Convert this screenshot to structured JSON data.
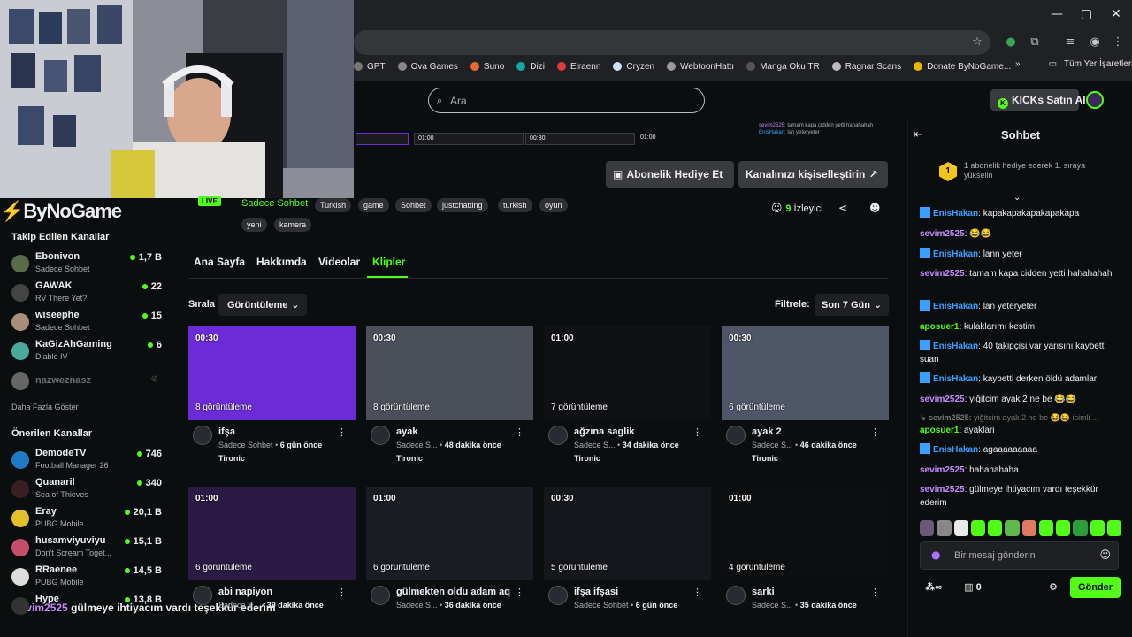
{
  "browser": {
    "bookmarks": [
      {
        "label": "GPT",
        "color": "#777"
      },
      {
        "label": "Ova Games",
        "color": "#888"
      },
      {
        "label": "Suno",
        "color": "#e66b2e"
      },
      {
        "label": "Dizi",
        "color": "#13a9a0"
      },
      {
        "label": "Elraenn",
        "color": "#e03a3a"
      },
      {
        "label": "Cryzen",
        "color": "#cfe0ff"
      },
      {
        "label": "WebtoonHattı",
        "color": "#999"
      },
      {
        "label": "Manga Oku TR",
        "color": "#555"
      },
      {
        "label": "Ragnar Scans",
        "color": "#bbb"
      },
      {
        "label": "Donate ByNoGame...",
        "color": "#e6b800"
      }
    ],
    "overflow": "»",
    "all_bookmarks": "Tüm Yer İşaretleri"
  },
  "header": {
    "search_placeholder": "Ara",
    "kicks_button": "KICKs Satın Al"
  },
  "brand": "ByNoGame",
  "sidebar": {
    "followed_title": "Takip Edilen Kanallar",
    "followed": [
      {
        "name": "Ebonivon",
        "game": "Sadece Sohbet",
        "viewers": "1,7 B",
        "color": "#5a6b4a"
      },
      {
        "name": "GAWAK",
        "game": "RV There Yet?",
        "viewers": "22",
        "color": "#444"
      },
      {
        "name": "wiseephe",
        "game": "Sadece Sohbet",
        "viewers": "15",
        "color": "#a98f7a"
      },
      {
        "name": "KaGizAhGaming",
        "game": "Diablo IV",
        "viewers": "6",
        "color": "#4aa99b"
      }
    ],
    "offline": {
      "name": "nazweznasz",
      "color": "#666"
    },
    "show_more": "Daha Fazla Göster",
    "recommended_title": "Önerilen Kanallar",
    "recommended": [
      {
        "name": "DemodeTV",
        "game": "Football Manager 26",
        "viewers": "746",
        "color": "#1f7cc4"
      },
      {
        "name": "Quanaril",
        "game": "Sea of Thieves",
        "viewers": "340",
        "color": "#3a1f22"
      },
      {
        "name": "Eray",
        "game": "PUBG Mobile",
        "viewers": "20,1 B",
        "color": "#e3c02a"
      },
      {
        "name": "husamviyuviyu",
        "game": "Don't Scream Toget...",
        "viewers": "15,1 B",
        "color": "#c44e6a"
      },
      {
        "name": "RRaenee",
        "game": "PUBG Mobile",
        "viewers": "14,5 B",
        "color": "#ddd"
      },
      {
        "name": "Hype",
        "game": "",
        "viewers": "13,8 B",
        "color": "#333"
      }
    ]
  },
  "overlay_message": {
    "user": "sevim2525",
    "text": "gülmeye ihtiyacım vardı teşekkür ederim"
  },
  "channel": {
    "live": "LIVE",
    "category": "Sadece Sohbet",
    "tags": [
      "Turkish",
      "game",
      "Sohbet",
      "justchatting",
      "turkish",
      "oyun",
      "yeni",
      "kamera"
    ],
    "gift_button": "Abonelik Hediye Et",
    "customize_button": "Kanalınızı kişiselleştirin",
    "viewers_count": "9",
    "viewers_label": "İzleyici",
    "tabs": [
      "Ana Sayfa",
      "Hakkımda",
      "Videolar",
      "Klipler"
    ]
  },
  "preview": {
    "times": [
      "01:00",
      "00:30",
      "01:00"
    ],
    "chat_snippet_user": "sevim2525:",
    "chat_snippet_text": "tamam kapa cidden yetti hahahahah",
    "chat_snippet_user2": "EnisHakan:",
    "chat_snippet_text2": "lan yeteryeter"
  },
  "clips_bar": {
    "sort_label": "Sırala",
    "sort_value": "Görüntüleme",
    "filter_label": "Filtrele:",
    "filter_value": "Son 7 Gün"
  },
  "clips": [
    {
      "duration": "00:30",
      "views": "8 görüntüleme",
      "title": "ifşa",
      "category": "Sadece Sohbet",
      "age": "6 gün önce",
      "channel": "Tironic",
      "bg": "#6b2bd6"
    },
    {
      "duration": "00:30",
      "views": "8 görüntüleme",
      "title": "ayak",
      "category": "Sadece S...",
      "age": "48 dakika önce",
      "channel": "Tironic",
      "bg": "#4a4f5a"
    },
    {
      "duration": "01:00",
      "views": "7 görüntüleme",
      "title": "ağzına saglik",
      "category": "Sadece S...",
      "age": "34 dakika önce",
      "channel": "Tironic",
      "bg": "#101114"
    },
    {
      "duration": "00:30",
      "views": "6 görüntüleme",
      "title": "ayak 2",
      "category": "Sadece S...",
      "age": "46 dakika önce",
      "channel": "Tironic",
      "bg": "#4f5668"
    },
    {
      "duration": "01:00",
      "views": "6 görüntüleme",
      "title": "abi napiyon",
      "category": "Sadece S...",
      "age": "39 dakika önce",
      "channel": "",
      "bg": "#2a1a44"
    },
    {
      "duration": "01:00",
      "views": "6 görüntüleme",
      "title": "gülmekten oldu adam aq",
      "category": "Sadece S...",
      "age": "36 dakika önce",
      "channel": "",
      "bg": "#1a1d24"
    },
    {
      "duration": "00:30",
      "views": "5 görüntüleme",
      "title": "ifşa ifşasi",
      "category": "Sadece Sohbet",
      "age": "6 gün önce",
      "channel": "",
      "bg": "#15171c"
    },
    {
      "duration": "01:00",
      "views": "4 görüntüleme",
      "title": "sarki",
      "category": "Sadece S...",
      "age": "35 dakika önce",
      "channel": "",
      "bg": "#0d0e10"
    }
  ],
  "chat": {
    "title": "Sohbet",
    "banner_rank": "1",
    "banner_text": "1 abonelik hediye ederek 1. sıraya yükselin",
    "messages": [
      {
        "user": "EnisHakan",
        "text": "kapakapakapakapakapa",
        "color": "#3b9fff",
        "badge": true
      },
      {
        "user": "sevim2525",
        "text": "😂😂",
        "color": "#c889ff",
        "badge": false
      },
      {
        "user": "EnisHakan",
        "text": "lann yeter",
        "color": "#3b9fff",
        "badge": true
      },
      {
        "user": "sevim2525",
        "text": "tamam kapa cidden yetti hahahahah",
        "color": "#c889ff",
        "badge": false
      },
      {
        "user": "EnisHakan",
        "text": "lan yeteryeter",
        "color": "#3b9fff",
        "badge": true
      },
      {
        "user": "aposuer1",
        "text": "kulaklarımı kestim",
        "color": "#53fc18",
        "badge": false
      },
      {
        "user": "EnisHakan",
        "text": "40 takipçisi var yarısını kaybetti şuan",
        "color": "#3b9fff",
        "badge": true
      },
      {
        "user": "EnisHakan",
        "text": "kaybetti derken öldü adamlar",
        "color": "#3b9fff",
        "badge": true
      },
      {
        "user": "sevim2525",
        "text": "yiğitcim ayak 2 ne be 😂😂",
        "color": "#c889ff",
        "badge": false
      },
      {
        "user": "↳ sevim2525:",
        "text": "yiğitcim ayak 2 ne be 😂😂 isimli ...",
        "color": "#777",
        "badge": false
      },
      {
        "user": "aposuer1",
        "text": "ayaklari",
        "color": "#53fc18",
        "badge": false
      },
      {
        "user": "EnisHakan",
        "text": "agaaaaaaaaa",
        "color": "#3b9fff",
        "badge": true
      },
      {
        "user": "sevim2525",
        "text": "hahahahaha",
        "color": "#c889ff",
        "badge": false
      },
      {
        "user": "sevim2525",
        "text": "gülmeye ihtiyacım vardı teşekkür ederim",
        "color": "#c889ff",
        "badge": false
      }
    ],
    "emote_colors": [
      "#6a5a7a",
      "#888",
      "#e9e9e9",
      "#53fc18",
      "#53fc18",
      "#5fb84a",
      "#e07a5f",
      "#53fc18",
      "#53fc18",
      "#2e9d3c",
      "#53fc18",
      "#53fc18"
    ],
    "input_placeholder": "Bir mesaj gönderin",
    "infinity": "∞",
    "kick_count": "0",
    "send_button": "Gönder"
  }
}
